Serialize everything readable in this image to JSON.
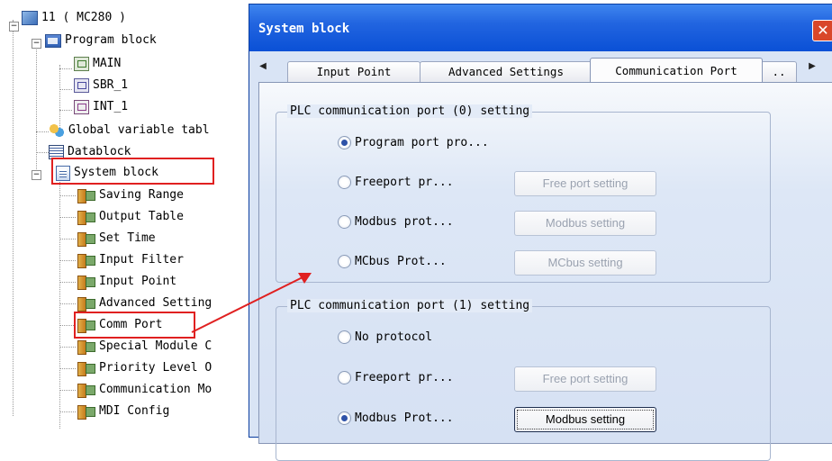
{
  "tree": {
    "root": "11  ( MC280 )",
    "program_block": "Program block",
    "main": "MAIN",
    "sbr": "SBR_1",
    "int": "INT_1",
    "global_var": "Global variable tabl",
    "datablock": "Datablock",
    "system_block": "System block",
    "children": [
      "Saving Range",
      "Output Table",
      "Set Time",
      "Input Filter",
      "Input Point",
      "Advanced Setting",
      "Comm Port",
      "Special Module C",
      "Priority Level O",
      "Communication Mo",
      "MDI Config"
    ]
  },
  "dialog": {
    "title": "System block",
    "close_label": "✕",
    "tabs": [
      {
        "label": "Input Point"
      },
      {
        "label": "Advanced Settings"
      },
      {
        "label": "Communication Port"
      },
      {
        "label": ".."
      }
    ],
    "port0": {
      "title": "PLC communication port (0) setting",
      "options": [
        {
          "label": "Program port pro...",
          "selected": true,
          "button": ""
        },
        {
          "label": "Freeport pr...",
          "selected": false,
          "button": "Free port setting"
        },
        {
          "label": "Modbus prot...",
          "selected": false,
          "button": "Modbus setting"
        },
        {
          "label": "MCbus Prot...",
          "selected": false,
          "button": "MCbus setting"
        }
      ]
    },
    "port1": {
      "title": "PLC communication port (1) setting",
      "options": [
        {
          "label": "No protocol",
          "selected": false,
          "button": ""
        },
        {
          "label": "Freeport pr...",
          "selected": false,
          "button": "Free port setting"
        },
        {
          "label": "Modbus Prot...",
          "selected": true,
          "button": "Modbus setting"
        }
      ]
    }
  },
  "colors": {
    "highlight": "#e02020",
    "titlebar": "#1a5ee0"
  }
}
